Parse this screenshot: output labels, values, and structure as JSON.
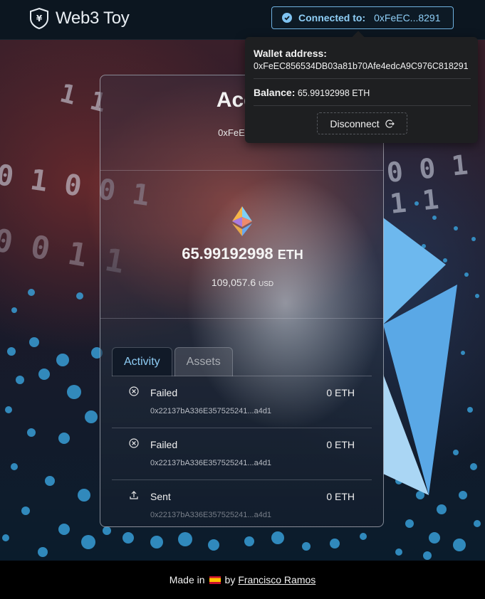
{
  "header": {
    "brand": "Web3 Toy",
    "connection": {
      "label": "Connected to:",
      "address_short": "0xFeEC...8291"
    }
  },
  "popover": {
    "wallet_label": "Wallet address:",
    "wallet_address": "0xFeEC856534DB03a81b70Afe4edcA9C976C818291",
    "balance_label": "Balance:",
    "balance_value": "65.99192998 ETH",
    "disconnect_label": "Disconnect"
  },
  "account": {
    "title": "Acco",
    "address_partial": "0xFeEC856",
    "balance": "65.99192998",
    "balance_unit": "ETH",
    "usd_value": "109,057.6",
    "usd_unit": "USD"
  },
  "tabs": [
    {
      "label": "Activity",
      "active": true
    },
    {
      "label": "Assets",
      "active": false
    }
  ],
  "activity": [
    {
      "icon": "failed-icon",
      "status": "Failed",
      "amount": "0 ETH",
      "hash": "0x22137bA336E357525241...a4d1"
    },
    {
      "icon": "failed-icon",
      "status": "Failed",
      "amount": "0 ETH",
      "hash": "0x22137bA336E357525241...a4d1"
    },
    {
      "icon": "sent-icon",
      "status": "Sent",
      "amount": "0 ETH",
      "hash": "0x22137bA336E357525241...a4d1"
    }
  ],
  "footer": {
    "made_in": "Made in",
    "by": "by",
    "author": "Francisco Ramos"
  },
  "background": {
    "binary_1": "1 1",
    "binary_2": "0 1 0 0 1",
    "binary_3": "0 0 1 1",
    "binary_4": "0 0 1 1 1"
  },
  "colors": {
    "accent": "#8ecdf5",
    "header_bg": "#0c1620",
    "popover_bg": "#1e1f21"
  }
}
